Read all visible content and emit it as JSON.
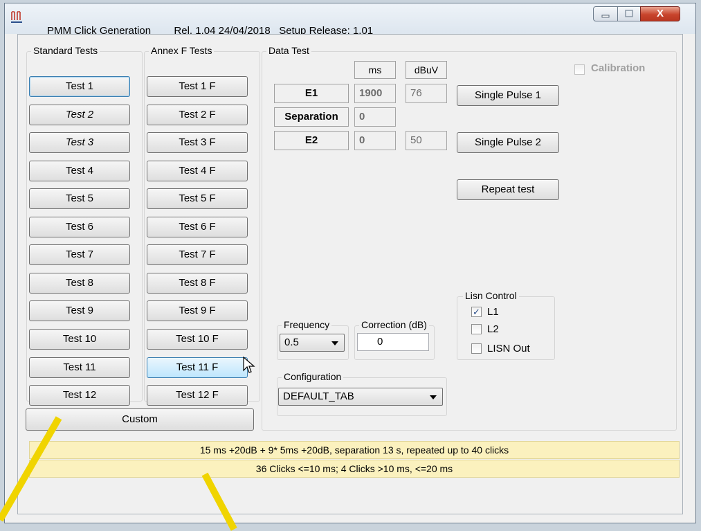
{
  "window": {
    "title": "PMM Click Generation",
    "release": "Rel. 1.04 24/04/2018",
    "setup_release": "Setup Release: 1.01",
    "close_symbol": "X"
  },
  "standard_tests": {
    "label": "Standard  Tests",
    "buttons": [
      "Test 1",
      "Test 2",
      "Test 3",
      "Test 4",
      "Test 5",
      "Test 6",
      "Test 7",
      "Test 8",
      "Test 9",
      "Test 10",
      "Test 11",
      "Test 12"
    ]
  },
  "annex_tests": {
    "label": "Annex F Tests",
    "buttons": [
      "Test 1 F",
      "Test 2 F",
      "Test 3 F",
      "Test 4 F",
      "Test 5 F",
      "Test 6 F",
      "Test 7 F",
      "Test 8 F",
      "Test 9 F",
      "Test 10 F",
      "Test 11 F",
      "Test 12 F"
    ]
  },
  "custom_button": "Custom",
  "data_test": {
    "label": "Data Test",
    "col_ms": "ms",
    "col_dbuv": "dBuV",
    "e1_label": "E1",
    "e1_ms": "1900",
    "e1_dbuv": "76",
    "separation_label": "Separation",
    "separation_ms": "0",
    "e2_label": "E2",
    "e2_ms": "0",
    "e2_dbuv": "50",
    "single_pulse_1": "Single Pulse 1",
    "single_pulse_2": "Single Pulse 2",
    "repeat_test": "Repeat test",
    "calibration_label": "Calibration",
    "frequency_label": "Frequency",
    "frequency_value": "0.5",
    "correction_label": "Correction (dB)",
    "correction_value": "0",
    "configuration_label": "Configuration",
    "configuration_value": "DEFAULT_TAB"
  },
  "lisn_control": {
    "label": "Lisn Control",
    "l1": "L1",
    "l2": "L2",
    "lisn_out": "LISN Out",
    "l1_checked": "✓"
  },
  "info": {
    "line1": "15 ms +20dB + 9* 5ms +20dB, separation 13 s, repeated up to 40 clicks",
    "line2": "36 Clicks <=10 ms; 4 Clicks >10 ms, <=20 ms"
  },
  "colors": {
    "info_bar": "#fbf1be",
    "hover_button": "#bee6fd",
    "annotation_line": "#f0d400"
  }
}
